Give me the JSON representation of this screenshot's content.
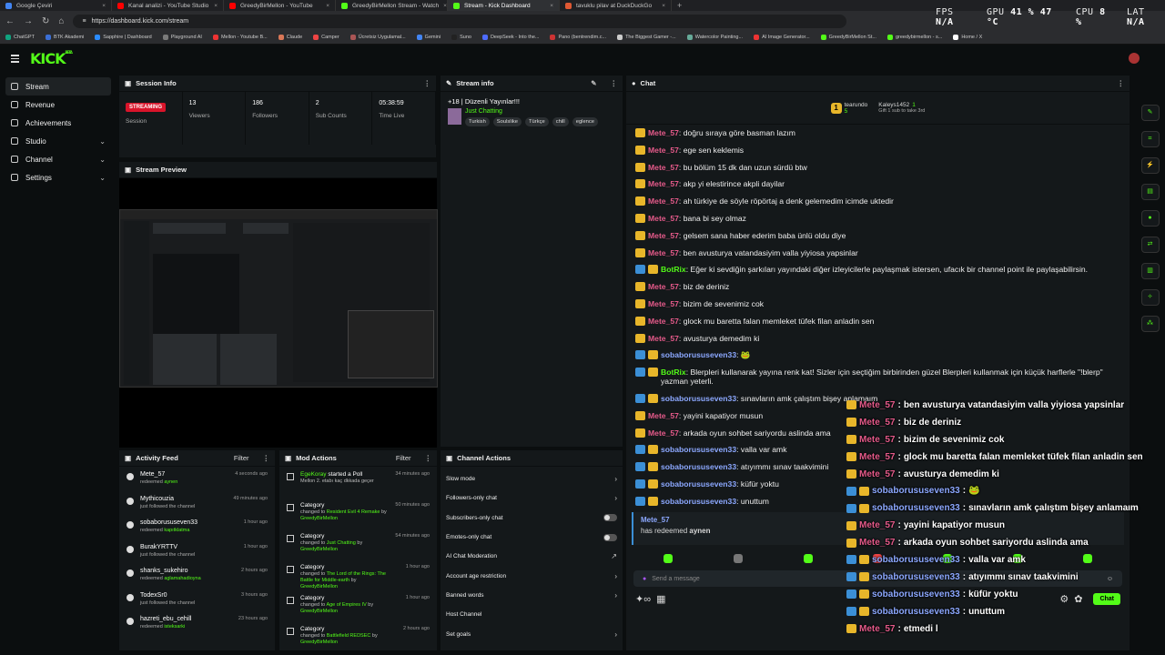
{
  "browser": {
    "tabs": [
      {
        "label": "Google Çeviri",
        "color": "#4285f4",
        "active": false
      },
      {
        "label": "Kanal analizi - YouTube Studio",
        "color": "#ff0000",
        "active": false
      },
      {
        "label": "GreedyBirMellon - YouTube",
        "color": "#ff0000",
        "active": false
      },
      {
        "label": "GreedyBirMellon Stream - Watch",
        "color": "#53fc18",
        "active": false
      },
      {
        "label": "Stream - Kick Dashboard",
        "color": "#53fc18",
        "active": true
      },
      {
        "label": "tavuklu pilav at DuckDuckGo",
        "color": "#de5833",
        "active": false
      }
    ],
    "url": "https://dashboard.kick.com/stream",
    "bookmarks": [
      "ChatGPT",
      "BTK Akademi",
      "Sapphire | Dashboard",
      "Playground AI",
      "Mellon - Youtube B...",
      "Claude",
      "Camper",
      "Ücretsiz Uygulamal...",
      "Gemini",
      "Suno",
      "DeepSeek - Into the...",
      "Pano (bentrendim.c...",
      "The Biggest Gamer -...",
      "Watercolor Painting...",
      "AI Image Generator...",
      "GreedyBirMellon St...",
      "greedybirmellon - s...",
      "Home / X"
    ]
  },
  "perf": {
    "fps_label": "FPS",
    "fps": "N/A",
    "gpu_label": "GPU",
    "gpu": "41 % 47 °C",
    "cpu_label": "CPU",
    "cpu": "8 %",
    "lat_label": "LAT",
    "lat": "N/A"
  },
  "app": {
    "logo": "KICK",
    "beta": "BETA"
  },
  "sidebar": [
    {
      "label": "Stream",
      "active": true,
      "chev": ""
    },
    {
      "label": "Revenue",
      "active": false,
      "chev": ""
    },
    {
      "label": "Achievements",
      "active": false,
      "chev": ""
    },
    {
      "label": "Studio",
      "active": false,
      "chev": "⌄"
    },
    {
      "label": "Channel",
      "active": false,
      "chev": "⌄"
    },
    {
      "label": "Settings",
      "active": false,
      "chev": "⌄"
    }
  ],
  "session": {
    "title": "Session Info",
    "status": "STREAMING",
    "stats": [
      {
        "value": "",
        "label": "Session"
      },
      {
        "value": "13",
        "label": "Viewers"
      },
      {
        "value": "186",
        "label": "Followers"
      },
      {
        "value": "2",
        "label": "Sub Counts"
      },
      {
        "value": "05:38:59",
        "label": "Time Live"
      }
    ]
  },
  "stream_info": {
    "title": "Stream info",
    "stream_title": "+18 | Düzenli Yayınlar!!!",
    "category": "Just Chatting",
    "tags": [
      "Turkish",
      "Soulslike",
      "Türkçe",
      "chill",
      "eglence"
    ]
  },
  "preview": {
    "title": "Stream Preview"
  },
  "chat": {
    "title": "Chat",
    "pinned": [
      {
        "name": "tearundo",
        "count": "5"
      },
      {
        "name": "Kaleys1452",
        "count": "1"
      }
    ],
    "gift_note": "Gift 1 sub to take 3rd",
    "messages": [
      {
        "user": "Mete_57",
        "color": "pink",
        "text": "doğru sıraya göre basman lazım",
        "bot": false
      },
      {
        "user": "Mete_57",
        "color": "pink",
        "text": "ege sen keklemis",
        "bot": false
      },
      {
        "user": "Mete_57",
        "color": "pink",
        "text": "bu bölüm 15 dk dan uzun sürdü btw",
        "bot": false
      },
      {
        "user": "Mete_57",
        "color": "pink",
        "text": "akp yi elestirince akpli dayilar",
        "bot": false
      },
      {
        "user": "Mete_57",
        "color": "pink",
        "text": "ah türkiye de söyle röpörtaj a denk gelemedim icimde uktedir",
        "bot": false
      },
      {
        "user": "Mete_57",
        "color": "pink",
        "text": "bana bi sey olmaz",
        "bot": false
      },
      {
        "user": "Mete_57",
        "color": "pink",
        "text": "gelsem sana haber ederim baba ünlü oldu diye",
        "bot": false
      },
      {
        "user": "Mete_57",
        "color": "pink",
        "text": "ben avusturya vatandasiyim valla yiyiosa yapsinlar",
        "bot": false
      },
      {
        "user": "BotRix",
        "color": "green",
        "text": "Eğer ki sevdiğin şarkıları yayındaki diğer izleyicilerle paylaşmak istersen, ufacık bir channel point ile paylaşabilirsin.",
        "bot": true
      },
      {
        "user": "Mete_57",
        "color": "pink",
        "text": "biz de deriniz",
        "bot": false
      },
      {
        "user": "Mete_57",
        "color": "pink",
        "text": "bizim de sevenimiz cok",
        "bot": false
      },
      {
        "user": "Mete_57",
        "color": "pink",
        "text": "glock mu baretta falan memleket tüfek filan anladin sen",
        "bot": false
      },
      {
        "user": "Mete_57",
        "color": "pink",
        "text": "avusturya demedim ki",
        "bot": false
      },
      {
        "user": "sobaborususeven33",
        "color": "blue",
        "text": "🐸",
        "bot": true
      },
      {
        "user": "BotRix",
        "color": "green",
        "text": "Blerpleri kullanarak yayına renk kat! Sizler için seçtiğim birbirinden güzel Blerpleri kullanmak için küçük harflerle \"!blerp\" yazman yeterli.",
        "bot": true
      },
      {
        "user": "sobaborususeven33",
        "color": "blue",
        "text": "sınavların amk çalıştım bişey anlamaım",
        "bot": true
      },
      {
        "user": "Mete_57",
        "color": "pink",
        "text": "yayini kapatiyor musun",
        "bot": false
      },
      {
        "user": "Mete_57",
        "color": "pink",
        "text": "arkada oyun sohbet sariyordu aslinda ama",
        "bot": false
      },
      {
        "user": "sobaborususeven33",
        "color": "blue",
        "text": "valla var amk",
        "bot": true
      },
      {
        "user": "sobaborususeven33",
        "color": "blue",
        "text": "atıyımmı sınav taakvimini",
        "bot": true
      },
      {
        "user": "sobaborususeven33",
        "color": "blue",
        "text": "küfür yoktu",
        "bot": true
      },
      {
        "user": "sobaborususeven33",
        "color": "blue",
        "text": "unuttum",
        "bot": true
      },
      {
        "user": "Mete_57",
        "color": "pink",
        "text": "etmedi l",
        "bot": false
      }
    ],
    "redeem": {
      "user": "Mete_57",
      "text": "has redeemed",
      "reward": "aynen"
    },
    "placeholder": "Send a message",
    "send": "Chat"
  },
  "overlay": [
    {
      "user": "Mete_57",
      "text": "ben avusturya vatandasiyim valla yiyiosa yapsinlar",
      "color": "pink"
    },
    {
      "user": "Mete_57",
      "text": "biz de deriniz",
      "color": "pink"
    },
    {
      "user": "Mete_57",
      "text": "bizim de sevenimiz cok",
      "color": "pink"
    },
    {
      "user": "Mete_57",
      "text": "glock mu baretta falan memleket tüfek filan anladin sen",
      "color": "pink"
    },
    {
      "user": "Mete_57",
      "text": "avusturya demedim ki",
      "color": "pink"
    },
    {
      "user": "sobaborususeven33",
      "text": "🐸",
      "color": "blue"
    },
    {
      "user": "sobaborususeven33",
      "text": "sınavların amk çalıştım bişey anlamaım",
      "color": "blue"
    },
    {
      "user": "Mete_57",
      "text": "yayini kapatiyor musun",
      "color": "pink"
    },
    {
      "user": "Mete_57",
      "text": "arkada oyun sohbet sariyordu aslinda ama",
      "color": "pink"
    },
    {
      "user": "sobaborususeven33",
      "text": "valla var amk",
      "color": "blue"
    },
    {
      "user": "sobaborususeven33",
      "text": "atıyımmı sınav taakvimini",
      "color": "blue"
    },
    {
      "user": "sobaborususeven33",
      "text": "küfür yoktu",
      "color": "blue"
    },
    {
      "user": "sobaborususeven33",
      "text": "unuttum",
      "color": "blue"
    },
    {
      "user": "Mete_57",
      "text": "etmedi l",
      "color": "pink"
    }
  ],
  "activity": {
    "title": "Activity Feed",
    "filter": "Filter",
    "items": [
      {
        "name": "Mete_57",
        "sub": "redeemed",
        "hl": "aynen",
        "time": "4 seconds ago"
      },
      {
        "name": "Mythicouzia",
        "sub": "just followed the channel",
        "hl": "",
        "time": "49 minutes ago"
      },
      {
        "name": "sobaborususeven33",
        "sub": "redeemed",
        "hl": "kapıtklatma",
        "time": "1 hour ago"
      },
      {
        "name": "BurakYRTTV",
        "sub": "just followed the channel",
        "hl": "",
        "time": "1 hour ago"
      },
      {
        "name": "shanks_sukehiro",
        "sub": "redeemed",
        "hl": "aglamahadioyna",
        "time": "2 hours ago"
      },
      {
        "name": "TodexSr0",
        "sub": "just followed the channel",
        "hl": "",
        "time": "3 hours ago"
      },
      {
        "name": "hazreti_ebu_cehill",
        "sub": "redeemed",
        "hl": "isteksarki",
        "time": "23 hours ago"
      }
    ]
  },
  "mod": {
    "title": "Mod Actions",
    "filter": "Filter",
    "items": [
      {
        "name": "EgeKoray",
        "act": "started a Poll",
        "line": "Mellon 2. etabı kaç dkkada geçer",
        "hl": "",
        "by": "",
        "time": "34 minutes ago"
      },
      {
        "name": "",
        "act": "Category",
        "line": "changed to",
        "hl": "Resident Evil 4 Remake",
        "by": "GreedyBirMellon",
        "time": "50 minutes ago"
      },
      {
        "name": "",
        "act": "Category",
        "line": "changed to",
        "hl": "Just Chatting",
        "by": "GreedyBirMellon",
        "time": "54 minutes ago"
      },
      {
        "name": "",
        "act": "Category",
        "line": "changed to",
        "hl": "The Lord of the Rings: The Battle for Middle-earth",
        "by": "GreedyBirMellon",
        "time": "1 hour ago"
      },
      {
        "name": "",
        "act": "Category",
        "line": "changed to",
        "hl": "Age of Empires IV",
        "by": "GreedyBirMellon",
        "time": "1 hour ago"
      },
      {
        "name": "",
        "act": "Category",
        "line": "changed to",
        "hl": "Battlefield REDSEC",
        "by": "GreedyBirMellon",
        "time": "2 hours ago"
      }
    ]
  },
  "channel_actions": {
    "title": "Channel Actions",
    "items": [
      {
        "label": "Slow mode",
        "ctrl": "arrow"
      },
      {
        "label": "Followers-only chat",
        "ctrl": "arrow"
      },
      {
        "label": "Subscribers-only chat",
        "ctrl": "toggle"
      },
      {
        "label": "Emotes-only chat",
        "ctrl": "toggle"
      },
      {
        "label": "AI Chat Moderation",
        "ctrl": "ext"
      },
      {
        "label": "Account age restriction",
        "ctrl": "arrow"
      },
      {
        "label": "Banned words",
        "ctrl": "arrow"
      },
      {
        "label": "Host Channel",
        "ctrl": "none"
      },
      {
        "label": "Set goals",
        "ctrl": "arrow"
      }
    ]
  },
  "rail": [
    "pen-icon",
    "scan-icon",
    "bolt-icon",
    "clipboard-icon",
    "message-icon",
    "link-icon",
    "stack-icon",
    "wrench-icon",
    "apps-icon"
  ]
}
